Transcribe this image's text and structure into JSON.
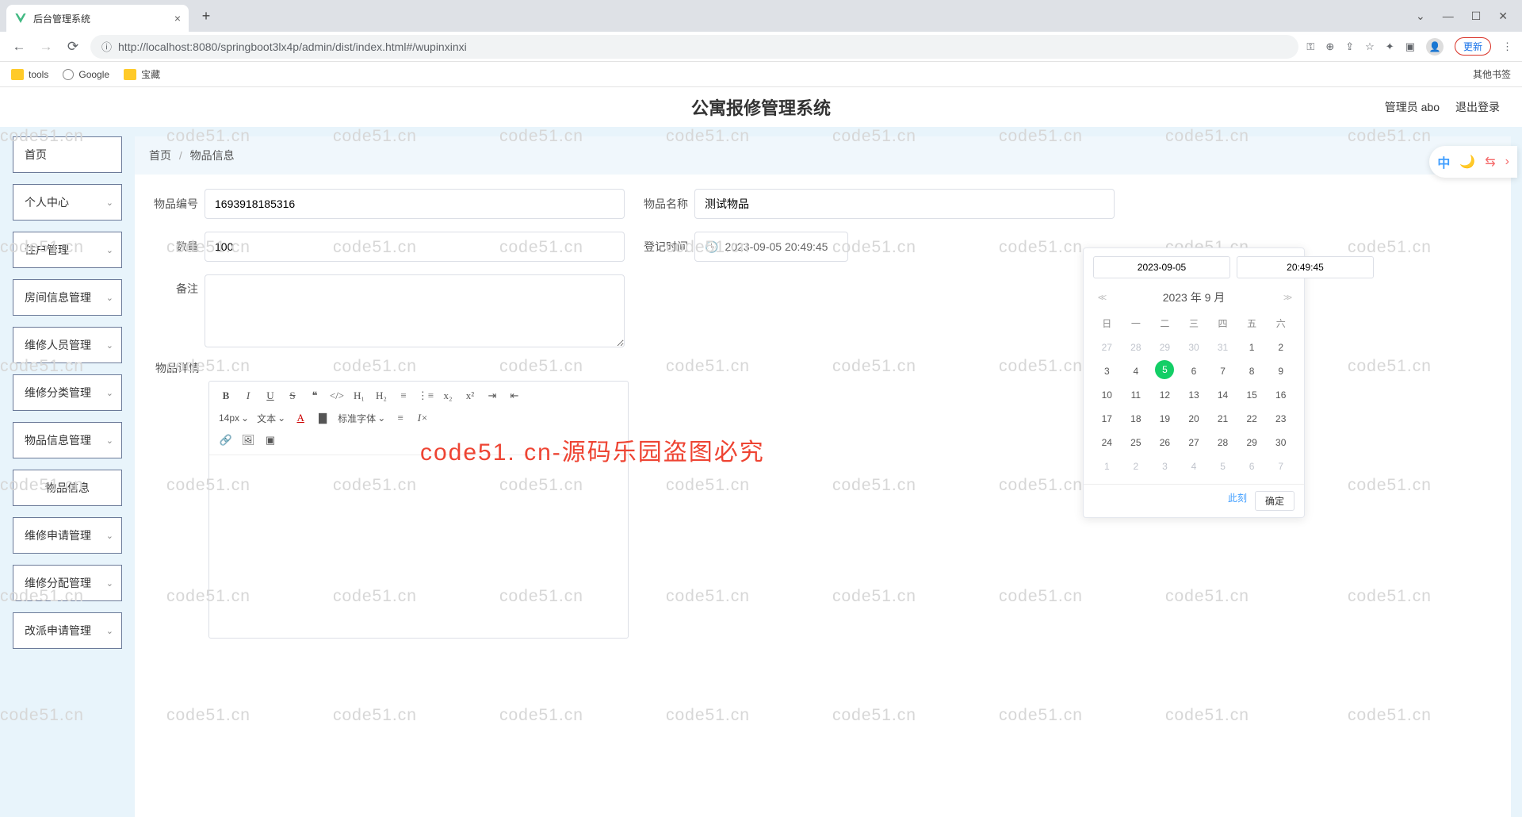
{
  "browser": {
    "tab_title": "后台管理系统",
    "url": "http://localhost:8080/springboot3lx4p/admin/dist/index.html#/wupinxinxi",
    "update_btn": "更新",
    "bookmarks": {
      "tools": "tools",
      "google": "Google",
      "treasure": "宝藏",
      "other": "其他书签"
    }
  },
  "header": {
    "title": "公寓报修管理系统",
    "user": "管理员 abo",
    "logout": "退出登录"
  },
  "sidebar": {
    "items": [
      "首页",
      "个人中心",
      "住户管理",
      "房间信息管理",
      "维修人员管理",
      "维修分类管理",
      "物品信息管理",
      "物品信息",
      "维修申请管理",
      "维修分配管理",
      "改派申请管理"
    ]
  },
  "breadcrumb": {
    "home": "首页",
    "current": "物品信息"
  },
  "form": {
    "labels": {
      "code": "物品编号",
      "name": "物品名称",
      "qty": "数量",
      "regtime": "登记时间",
      "remark": "备注",
      "detail": "物品详情"
    },
    "values": {
      "code": "1693918185316",
      "name": "测试物品",
      "qty": "100",
      "regtime": "2023-09-05 20:49:45",
      "remark": ""
    },
    "toolbar": {
      "size": "14px",
      "text": "文本",
      "font": "标准字体"
    }
  },
  "datepicker": {
    "date_input": "2023-09-05",
    "time_input": "20:49:45",
    "title": "2023 年 9 月",
    "dow": [
      "日",
      "一",
      "二",
      "三",
      "四",
      "五",
      "六"
    ],
    "prev_month": [
      "27",
      "28",
      "29",
      "30",
      "31"
    ],
    "days": [
      "1",
      "2",
      "3",
      "4",
      "5",
      "6",
      "7",
      "8",
      "9",
      "10",
      "11",
      "12",
      "13",
      "14",
      "15",
      "16",
      "17",
      "18",
      "19",
      "20",
      "21",
      "22",
      "23",
      "24",
      "25",
      "26",
      "27",
      "28",
      "29",
      "30"
    ],
    "next_month": [
      "1",
      "2",
      "3",
      "4",
      "5",
      "6",
      "7"
    ],
    "selected": "5",
    "now": "此刻",
    "ok": "确定"
  },
  "float": {
    "lang": "中"
  },
  "watermark": "code51.cn",
  "watermark_red": "code51. cn-源码乐园盗图必究"
}
